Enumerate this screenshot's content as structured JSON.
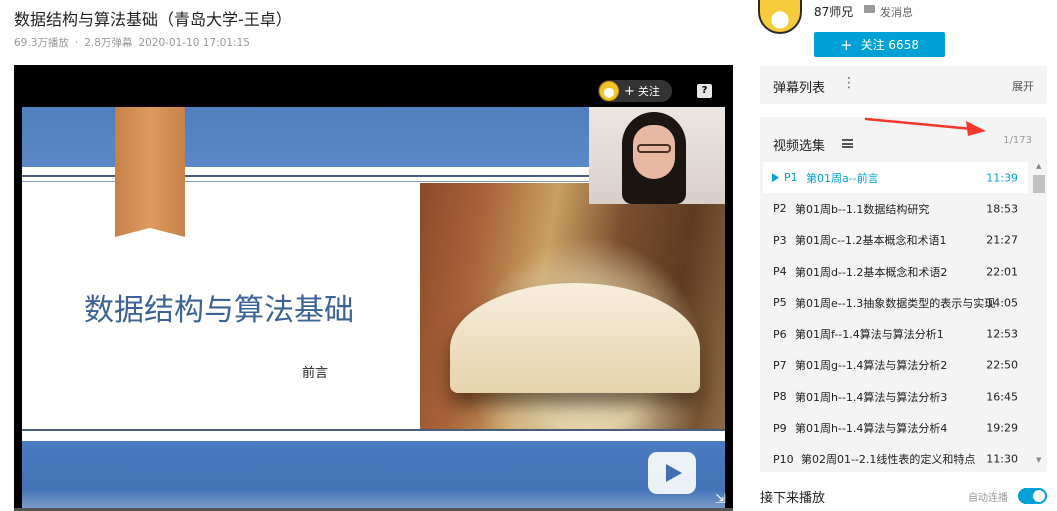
{
  "video": {
    "title": "数据结构与算法基础（青岛大学-王卓）",
    "views": "69.3万播放",
    "separator": "·",
    "danmaku_count": "2.8万弹幕",
    "published": "2020-01-10 17:01:15"
  },
  "player": {
    "slide_title": "数据结构与算法基础",
    "slide_subtitle": "前言",
    "follow_label": "关注",
    "help_label": "?",
    "expand_glyph": "⇲"
  },
  "up": {
    "name": "87师兄",
    "message_label": "发消息",
    "follow_button": "关注 6658"
  },
  "danmaku_panel": {
    "title": "弹幕列表",
    "expand_label": "展开"
  },
  "playlist": {
    "title": "视频选集",
    "count": "1/173",
    "items": [
      {
        "ep": "P1",
        "label": "第01周a--前言",
        "duration": "11:39"
      },
      {
        "ep": "P2",
        "label": "第01周b--1.1数据结构研究",
        "duration": "18:53"
      },
      {
        "ep": "P3",
        "label": "第01周c--1.2基本概念和术语1",
        "duration": "21:27"
      },
      {
        "ep": "P4",
        "label": "第01周d--1.2基本概念和术语2",
        "duration": "22:01"
      },
      {
        "ep": "P5",
        "label": "第01周e--1.3抽象数据类型的表示与实现",
        "duration": "14:05"
      },
      {
        "ep": "P6",
        "label": "第01周f--1.4算法与算法分析1",
        "duration": "12:53"
      },
      {
        "ep": "P7",
        "label": "第01周g--1.4算法与算法分析2",
        "duration": "22:50"
      },
      {
        "ep": "P8",
        "label": "第01周h--1.4算法与算法分析3",
        "duration": "16:45"
      },
      {
        "ep": "P9",
        "label": "第01周h--1.4算法与算法分析4",
        "duration": "19:29"
      },
      {
        "ep": "P10",
        "label": "第02周01--2.1线性表的定义和特点",
        "duration": "11:30"
      }
    ]
  },
  "next_up": {
    "title": "接下来播放",
    "autoplay_label": "自动连播",
    "autoplay_on": true
  },
  "colors": {
    "accent": "#00a1d6",
    "annotation_arrow": "#f5382b"
  }
}
